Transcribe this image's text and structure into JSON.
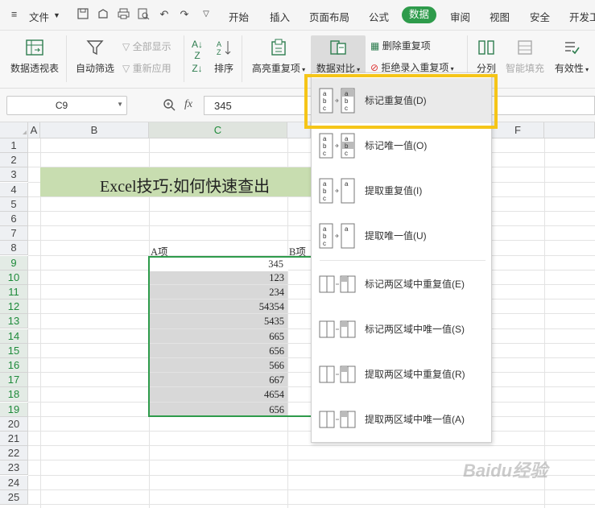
{
  "menubar": {
    "file_label": "文件",
    "tabs": [
      "开始",
      "插入",
      "页面布局",
      "公式",
      "数据",
      "审阅",
      "视图",
      "安全",
      "开发工"
    ],
    "active_tab": "数据"
  },
  "ribbon": {
    "pivot": "数据透视表",
    "autofilter": "自动筛选",
    "show_all": "全部显示",
    "reapply": "重新应用",
    "sort": "排序",
    "highlight_dup": "高亮重复项",
    "compare": "数据对比",
    "remove_dup": "删除重复项",
    "reject_dup": "拒绝录入重复项",
    "split": "分列",
    "smart_fill": "智能填充",
    "validity": "有效性"
  },
  "formula_bar": {
    "cell_ref": "C9",
    "fx": "fx",
    "value": "345"
  },
  "columns": [
    "A",
    "B",
    "C",
    "F"
  ],
  "rows": [
    "1",
    "2",
    "3",
    "4",
    "5",
    "6",
    "7",
    "8",
    "9",
    "10",
    "11",
    "12",
    "13",
    "14",
    "15",
    "16",
    "17",
    "18",
    "19",
    "20",
    "21",
    "22",
    "23",
    "24",
    "25"
  ],
  "sheet": {
    "title": "Excel技巧:如何快速查出",
    "header_a": "A项",
    "header_b": "B项",
    "values_a": [
      "345",
      "123",
      "234",
      "54354",
      "5435",
      "665",
      "656",
      "566",
      "667",
      "4654",
      "656"
    ]
  },
  "dropdown": {
    "items": [
      "标记重复值(D)",
      "标记唯一值(O)",
      "提取重复值(I)",
      "提取唯一值(U)",
      "标记两区域中重复值(E)",
      "标记两区域中唯一值(S)",
      "提取两区域中重复值(R)",
      "提取两区域中唯一值(A)"
    ]
  },
  "watermark": "Baidu经验",
  "colors": {
    "accent": "#2e9b4b",
    "highlight_border": "#f5c518",
    "selection_fill": "#d8d8d8"
  }
}
